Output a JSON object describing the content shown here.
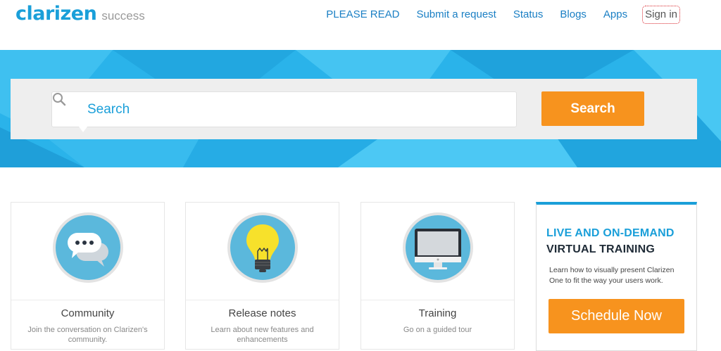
{
  "header": {
    "logo_word": "clarizen",
    "logo_sub": "success",
    "nav": [
      {
        "label": "PLEASE READ"
      },
      {
        "label": "Submit a request"
      },
      {
        "label": "Status"
      },
      {
        "label": "Blogs"
      },
      {
        "label": "Apps"
      },
      {
        "label": "Sign in"
      }
    ]
  },
  "search": {
    "placeholder": "Search",
    "button_label": "Search"
  },
  "cards": [
    {
      "title": "Community",
      "description": "Join the conversation on Clarizen's community.",
      "icon": "chat-bubbles-icon"
    },
    {
      "title": "Release notes",
      "description": "Learn about new features and enhancements",
      "icon": "lightbulb-icon"
    },
    {
      "title": "Training",
      "description": "Go on a guided tour",
      "icon": "monitor-icon"
    }
  ],
  "promo": {
    "heading_1": "LIVE AND ON-DEMAND",
    "heading_2": "VIRTUAL TRAINING",
    "body": "Learn how to visually present Clarizen One to fit the way your users work.",
    "cta_label": "Schedule Now"
  },
  "colors": {
    "brand_blue": "#1a9fd9",
    "hero_blue": "#2ab3ea",
    "accent_orange": "#f7931e",
    "icon_circle": "#5bb8dc"
  }
}
